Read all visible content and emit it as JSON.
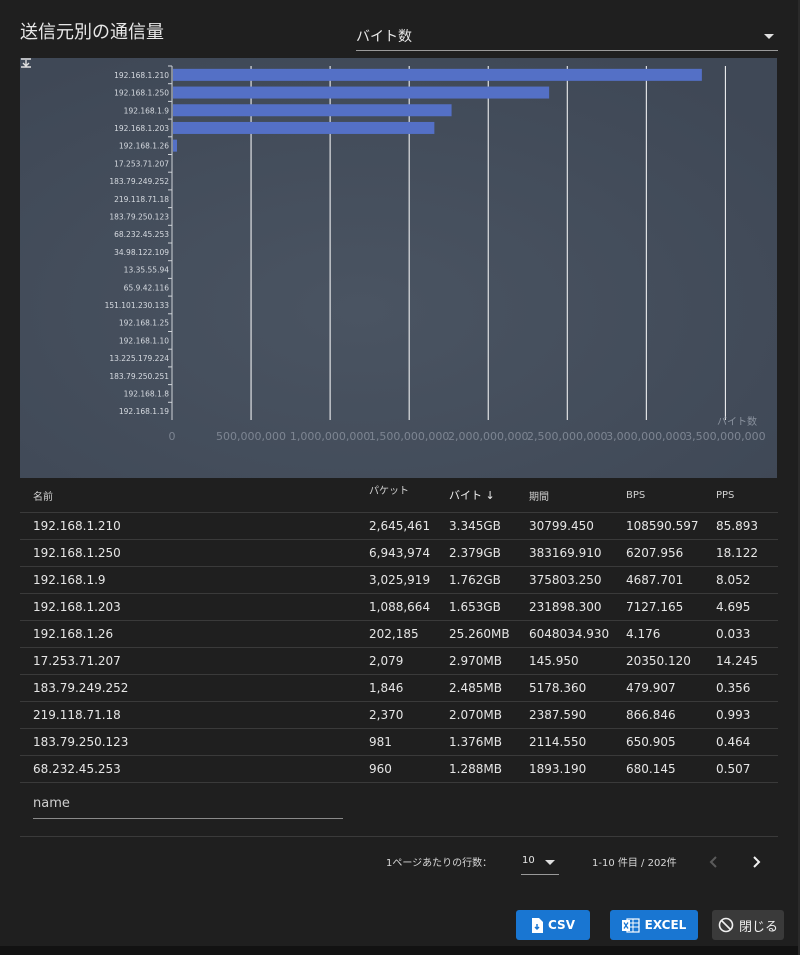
{
  "dialog": {
    "title": "送信元別の通信量",
    "metric_select": {
      "value": "バイト数"
    }
  },
  "chart_data": {
    "type": "bar",
    "orientation": "horizontal",
    "categories": [
      "192.168.1.210",
      "192.168.1.250",
      "192.168.1.9",
      "192.168.1.203",
      "192.168.1.26",
      "17.253.71.207",
      "183.79.249.252",
      "219.118.71.18",
      "183.79.250.123",
      "68.232.45.253",
      "34.98.122.109",
      "13.35.55.94",
      "65.9.42.116",
      "151.101.230.133",
      "192.168.1.25",
      "192.168.1.10",
      "13.225.179.224",
      "183.79.250.251",
      "192.168.1.8",
      "192.168.1.19"
    ],
    "values": [
      3345000000,
      2379000000,
      1762000000,
      1653000000,
      25260000,
      2970000,
      2485000,
      2070000,
      1376000,
      1288000,
      1000000,
      900000,
      800000,
      700000,
      600000,
      500000,
      400000,
      300000,
      200000,
      100000
    ],
    "xlabel": "バイト数",
    "xlim": [
      0,
      3700000000
    ],
    "xticks": [
      "0",
      "500,000,000",
      "1,000,000,000",
      "1,500,000,000",
      "2,000,000,000",
      "2,500,000,000",
      "3,000,000,000",
      "3,500,000,000"
    ],
    "xtick_values": [
      0,
      500000000,
      1000000000,
      1500000000,
      2000000000,
      2500000000,
      3000000000,
      3500000000
    ],
    "bar_color": "#5470c6",
    "grid": true
  },
  "table": {
    "headers": {
      "name": "名前",
      "packets": "パケット",
      "bytes": "バイト",
      "period": "期間",
      "bps": "BPS",
      "pps": "PPS"
    },
    "sort_icon": "arrow-down-icon",
    "rows": [
      {
        "name": "192.168.1.210",
        "packets": "2,645,461",
        "bytes": "3.345GB",
        "period": "30799.450",
        "bps": "108590.597",
        "pps": "85.893"
      },
      {
        "name": "192.168.1.250",
        "packets": "6,943,974",
        "bytes": "2.379GB",
        "period": "383169.910",
        "bps": "6207.956",
        "pps": "18.122"
      },
      {
        "name": "192.168.1.9",
        "packets": "3,025,919",
        "bytes": "1.762GB",
        "period": "375803.250",
        "bps": "4687.701",
        "pps": "8.052"
      },
      {
        "name": "192.168.1.203",
        "packets": "1,088,664",
        "bytes": "1.653GB",
        "period": "231898.300",
        "bps": "7127.165",
        "pps": "4.695"
      },
      {
        "name": "192.168.1.26",
        "packets": "202,185",
        "bytes": "25.260MB",
        "period": "6048034.930",
        "bps": "4.176",
        "pps": "0.033"
      },
      {
        "name": "17.253.71.207",
        "packets": "2,079",
        "bytes": "2.970MB",
        "period": "145.950",
        "bps": "20350.120",
        "pps": "14.245"
      },
      {
        "name": "183.79.249.252",
        "packets": "1,846",
        "bytes": "2.485MB",
        "period": "5178.360",
        "bps": "479.907",
        "pps": "0.356"
      },
      {
        "name": "219.118.71.18",
        "packets": "2,370",
        "bytes": "2.070MB",
        "period": "2387.590",
        "bps": "866.846",
        "pps": "0.993"
      },
      {
        "name": "183.79.250.123",
        "packets": "981",
        "bytes": "1.376MB",
        "period": "2114.550",
        "bps": "650.905",
        "pps": "0.464"
      },
      {
        "name": "68.232.45.253",
        "packets": "960",
        "bytes": "1.288MB",
        "period": "1893.190",
        "bps": "680.145",
        "pps": "0.507"
      }
    ]
  },
  "filter": {
    "placeholder": "name"
  },
  "pagination": {
    "rows_per_page_label": "1ページあたりの行数：",
    "rows_per_page": "10",
    "range": "1-10 件目 / 202件"
  },
  "buttons": {
    "csv": "CSV",
    "excel": "EXCEL",
    "close": "閉じる"
  },
  "colors": {
    "accent": "#1976d2",
    "chart_bg": "#434d5b",
    "bar": "#5470c6"
  }
}
